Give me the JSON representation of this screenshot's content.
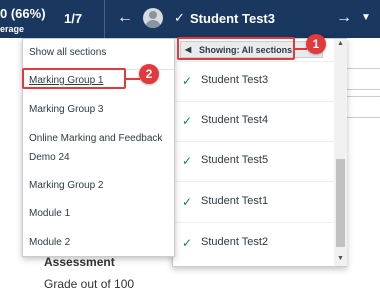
{
  "header": {
    "score": "0 (66%)",
    "score_sub": "erage",
    "pager": "1/7",
    "prev_icon": "←",
    "next_icon": "→",
    "current_student": "Student Test3",
    "check_icon": "✓",
    "caret_icon": "▼"
  },
  "section_menu": {
    "header": "Show all sections",
    "items": [
      {
        "label": "Marking Group 1",
        "selected": true
      },
      {
        "label": "Marking Group 3"
      },
      {
        "label": "Online Marking and Feedback"
      },
      {
        "label": "Demo 24"
      },
      {
        "label": "Marking Group 2"
      },
      {
        "label": "Module 1"
      },
      {
        "label": "Module 2"
      }
    ]
  },
  "student_menu": {
    "showing_label": "Showing: All sections",
    "back_icon": "◀",
    "students": [
      {
        "name": "Student Test3",
        "check": "✓"
      },
      {
        "name": "Student Test4",
        "check": "✓"
      },
      {
        "name": "Student Test5",
        "check": "✓"
      },
      {
        "name": "Student Test1",
        "check": "✓"
      },
      {
        "name": "Student Test2",
        "check": "✓"
      }
    ]
  },
  "page": {
    "assessment_title": "Assessment",
    "grade_out_of": "Grade out of 100"
  },
  "callouts": [
    {
      "number": "1"
    },
    {
      "number": "2"
    }
  ],
  "colors": {
    "header_bg": "#19375f",
    "callout": "#e2393d",
    "check": "#0b874b"
  }
}
